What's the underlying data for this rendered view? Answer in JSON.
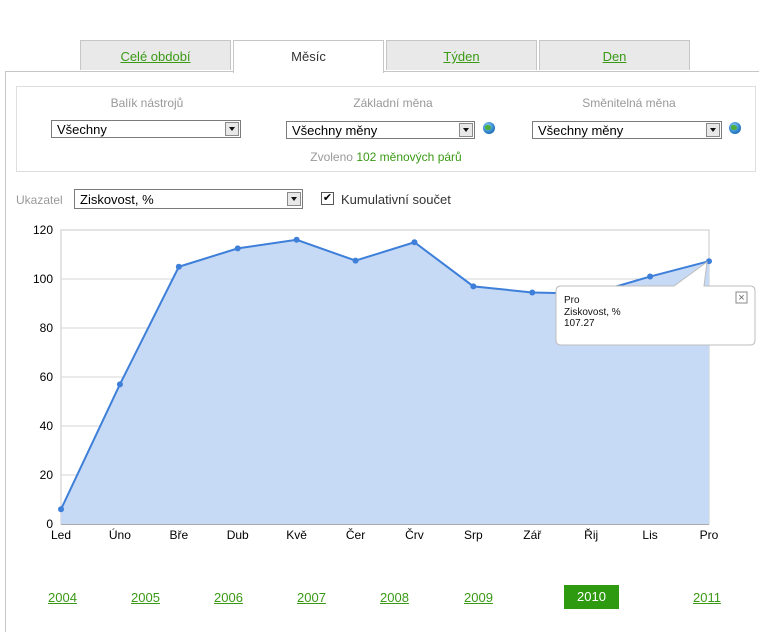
{
  "tabs": [
    "Celé období",
    "Měsíc",
    "Týden",
    "Den"
  ],
  "active_tab": 1,
  "filters": {
    "toolkit": {
      "label": "Balík nástrojů",
      "value": "Všechny"
    },
    "base_currency": {
      "label": "Základní měna",
      "value": "Všechny měny"
    },
    "quote_currency": {
      "label": "Směnitelná měna",
      "value": "Všechny měny"
    },
    "selected_prefix": "Zvoleno",
    "selected_link": "102 měnových párů"
  },
  "indicator": {
    "label": "Ukazatel",
    "value": "Ziskovost, %"
  },
  "cumulative": {
    "label": "Kumulativní součet",
    "checked": true
  },
  "tooltip": {
    "month": "Pro",
    "metric": "Ziskovost, %",
    "value": "107.27"
  },
  "chart_data": {
    "type": "area",
    "categories": [
      "Led",
      "Úno",
      "Bře",
      "Dub",
      "Kvě",
      "Čer",
      "Črv",
      "Srp",
      "Zář",
      "Řij",
      "Lis",
      "Pro"
    ],
    "series": [
      {
        "values": [
          6,
          57,
          105,
          112.5,
          116,
          107.5,
          115,
          97,
          94.5,
          94,
          101,
          107.27
        ]
      }
    ],
    "ylim": [
      0,
      120
    ],
    "yticks": [
      0,
      20,
      40,
      60,
      80,
      100,
      120
    ],
    "grid": true,
    "colors": {
      "line": "#3d7fd9",
      "fill": "#c6d9f5"
    }
  },
  "years": [
    "2004",
    "2005",
    "2006",
    "2007",
    "2008",
    "2009",
    "2010",
    "2011"
  ],
  "active_year": "2010"
}
